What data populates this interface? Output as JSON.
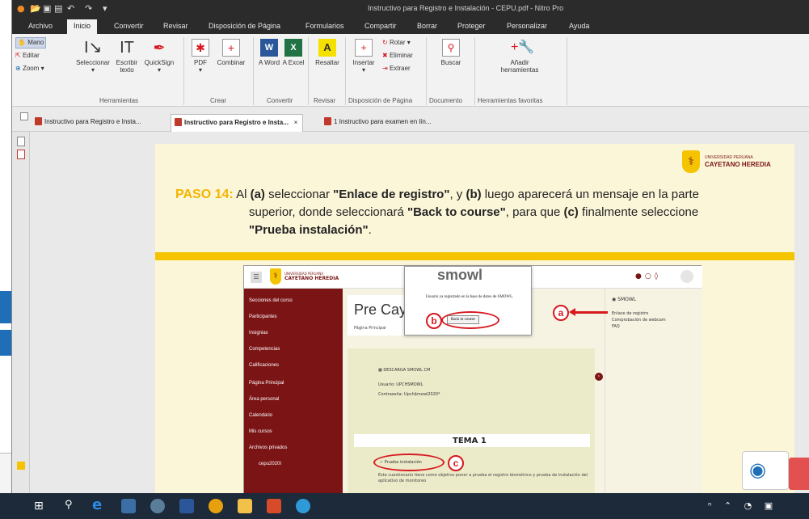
{
  "window": {
    "title": "Instructivo para Registro e Instalación - CEPU.pdf - Nitro Pro"
  },
  "menu": {
    "tabs": [
      "Archivo",
      "Inicio",
      "Convertir",
      "Revisar",
      "Disposición de Página",
      "Formularios",
      "Compartir",
      "Borrar",
      "Proteger",
      "Personalizar",
      "Ayuda"
    ],
    "active": "Inicio"
  },
  "ribbon": {
    "mano": "Mano",
    "editar": "Editar",
    "zoom": "Zoom",
    "seleccionar": "Seleccionar",
    "escribir_texto": "Escribir texto",
    "quicksign": "QuickSign",
    "pdf": "PDF",
    "combinar": "Combinar",
    "a_word": "A Word",
    "a_excel": "A Excel",
    "resaltar": "Resaltar",
    "insertar": "Insertar",
    "rotar": "Rotar",
    "eliminar": "Eliminar",
    "extraer": "Extraer",
    "buscar": "Buscar",
    "anadir_herramientas": "Añadir herramientas",
    "groups": {
      "herramientas": "Herramientas",
      "crear": "Crear",
      "convertir": "Convertir",
      "revisar": "Revisar",
      "disposicion": "Disposición de Página",
      "documento": "Documento",
      "favoritas": "Herramientas favoritas"
    }
  },
  "doc_tabs": [
    {
      "label": "Instructivo para Registro e Insta..."
    },
    {
      "label": "Instructivo para Registro e Insta...",
      "close": "×"
    },
    {
      "label": "1 Instructivo para examen en lín..."
    }
  ],
  "slide": {
    "logo_small": "UNIVERSIDAD PERUANA",
    "logo_name": "CAYETANO HEREDIA",
    "step_label": "PASO 14:",
    "line1_a": "Al ",
    "line1_b": "(a)",
    "line1_c": " seleccionar ",
    "line1_d": "\"Enlace de registro\"",
    "line1_e": ", y ",
    "line1_f": "(b)",
    "line1_g": " luego aparecerá un mensaje en la parte",
    "line2_a": "superior, donde seleccionará ",
    "line2_b": "\"Back to course\"",
    "line2_c": ", para que ",
    "line2_d": "(c)",
    "line2_e": " finalmente seleccione",
    "line3": "\"Prueba instalación\"",
    "line3_end": "."
  },
  "shot": {
    "logo_small": "UNIVERSIDAD PERUANA",
    "logo_name": "CAYETANO HEREDIA",
    "sidebar": [
      "Secciones del curso",
      "Participantes",
      "Insignias",
      "Competencias",
      "Calificaciones",
      "Página Principal",
      "Área personal",
      "Calendario",
      "Mis cursos",
      "Archivos privados",
      "cepu2020I"
    ],
    "course_title": "Pre Cay",
    "breadcrumb": "Página Principal",
    "popup_brand": "smowl",
    "popup_msg": "Usuario ya registrado en la base de datos de SMOWL.",
    "popup_button": "Back to course",
    "right_title": "SMOWL",
    "right_links": [
      "Enlace de registro",
      "Comprobación de webcam",
      "FAQ"
    ],
    "download": "DESCARGA SMOWL CM",
    "usuario": "Usuario: UPCHSMOWL",
    "contrasena": "Contraseña: Upch$mowl2020*",
    "tema": "TEMA 1",
    "prueba": "Prueba instalación",
    "desc": "Este cuestionario tiene como objetivo poner a prueba el registro biométrico y prueba de instalación del aplicativo de monitoreo",
    "markers": {
      "a": "a",
      "b": "b",
      "c": "c"
    }
  },
  "colors": {
    "accent_red": "#d71920",
    "upch_maroon": "#7b1414",
    "step_yellow": "#f4c400",
    "taskbar": "#1c2a3a"
  }
}
